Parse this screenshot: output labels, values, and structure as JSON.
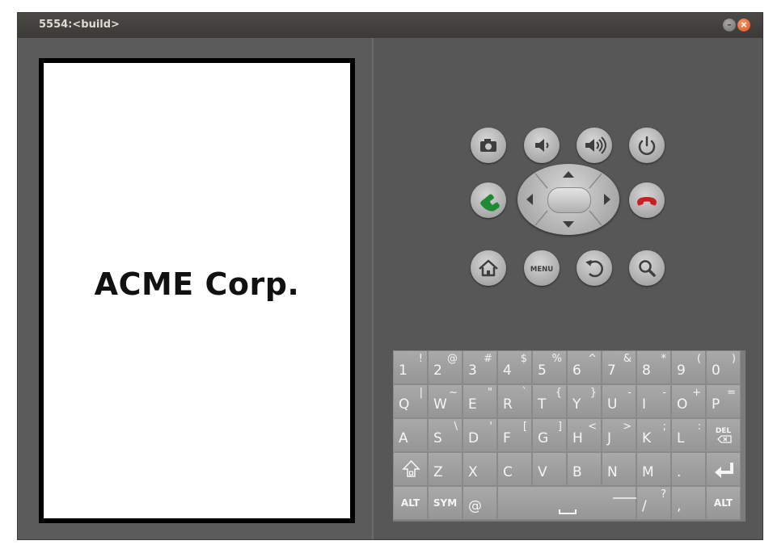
{
  "window": {
    "title": "5554:<build>",
    "minimize_icon": "minimize-icon",
    "close_icon": "close-icon"
  },
  "screen": {
    "content_text": "ACME Corp."
  },
  "controls": {
    "icons": [
      "camera-icon",
      "volume-down-icon",
      "volume-up-icon",
      "power-icon",
      "call-icon",
      "dpad",
      "end-call-icon",
      "home-icon",
      "menu-icon",
      "back-icon",
      "search-icon"
    ],
    "menu_label": "MENU",
    "call_color": "#1f8a32",
    "end_call_color": "#c62020"
  },
  "keyboard": {
    "row1": [
      {
        "main": "1",
        "alt": "!"
      },
      {
        "main": "2",
        "alt": "@"
      },
      {
        "main": "3",
        "alt": "#"
      },
      {
        "main": "4",
        "alt": "$"
      },
      {
        "main": "5",
        "alt": "%"
      },
      {
        "main": "6",
        "alt": "^"
      },
      {
        "main": "7",
        "alt": "&"
      },
      {
        "main": "8",
        "alt": "*"
      },
      {
        "main": "9",
        "alt": "("
      },
      {
        "main": "0",
        "alt": ")"
      }
    ],
    "row2": [
      {
        "main": "Q",
        "alt": "|"
      },
      {
        "main": "W",
        "alt": "~"
      },
      {
        "main": "E",
        "alt": "\""
      },
      {
        "main": "R",
        "alt": "`"
      },
      {
        "main": "T",
        "alt": "{"
      },
      {
        "main": "Y",
        "alt": "}"
      },
      {
        "main": "U",
        "alt": "-"
      },
      {
        "main": "I",
        "alt": "-"
      },
      {
        "main": "O",
        "alt": "+"
      },
      {
        "main": "P",
        "alt": "="
      }
    ],
    "row3": [
      {
        "main": "A",
        "alt": ""
      },
      {
        "main": "S",
        "alt": "\\"
      },
      {
        "main": "D",
        "alt": "'"
      },
      {
        "main": "F",
        "alt": "["
      },
      {
        "main": "G",
        "alt": "]"
      },
      {
        "main": "H",
        "alt": "<"
      },
      {
        "main": "J",
        "alt": ">"
      },
      {
        "main": "K",
        "alt": ";"
      },
      {
        "main": "L",
        "alt": ":"
      }
    ],
    "del_label": "DEL",
    "row4": [
      {
        "main": "Z",
        "alt": ""
      },
      {
        "main": "X",
        "alt": ""
      },
      {
        "main": "C",
        "alt": ""
      },
      {
        "main": "V",
        "alt": ""
      },
      {
        "main": "B",
        "alt": ""
      },
      {
        "main": "N",
        "alt": ""
      },
      {
        "main": "M",
        "alt": ""
      },
      {
        "main": ".",
        "alt": ""
      }
    ],
    "alt_label": "ALT",
    "sym_label": "SYM",
    "at_label": "@",
    "slash": {
      "main": "/",
      "alt": "?"
    },
    "comma": ","
  }
}
